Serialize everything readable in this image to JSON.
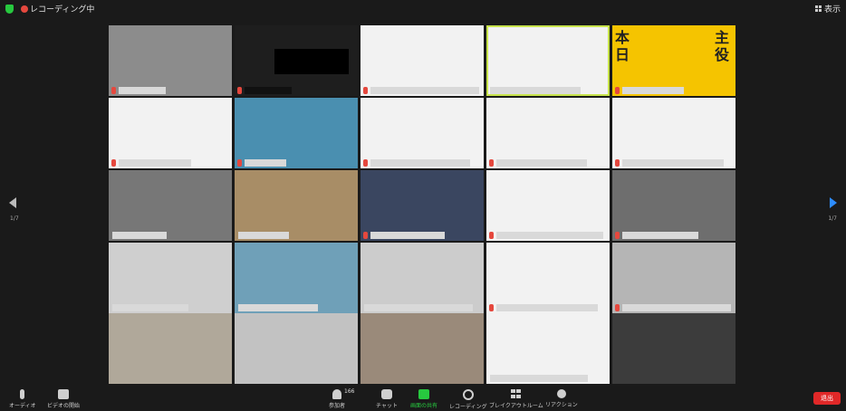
{
  "topbar": {
    "recording_label": "レコーディング中",
    "view_label": "表示"
  },
  "gallery": {
    "page_left": "1/7",
    "page_right": "1/7"
  },
  "tiles": [
    {
      "bg": "#8c8c8c"
    },
    {
      "bg": "#1e1e1e"
    },
    {
      "bg": "#f2f2f2"
    },
    {
      "bg": "#f2f2f2"
    },
    {
      "bg": "#f5c400"
    },
    {
      "bg": "#f2f2f2"
    },
    {
      "bg": "#4a8fb0"
    },
    {
      "bg": "#f2f2f2"
    },
    {
      "bg": "#f2f2f2"
    },
    {
      "bg": "#f2f2f2"
    },
    {
      "bg": "#777777"
    },
    {
      "bg": "#a88d66"
    },
    {
      "bg": "#3a4660"
    },
    {
      "bg": "#f2f2f2"
    },
    {
      "bg": "#6e6e6e"
    },
    {
      "bg": "#cfcfcf"
    },
    {
      "bg": "#6fa0b8"
    },
    {
      "bg": "#cccccc"
    },
    {
      "bg": "#f2f2f2"
    },
    {
      "bg": "#b5b5b5"
    },
    {
      "bg": "#b0a89a"
    },
    {
      "bg": "#c2c2c2"
    },
    {
      "bg": "#9a8a7a"
    },
    {
      "bg": "#f2f2f2"
    },
    {
      "bg": "#3c3c3c"
    }
  ],
  "tile_banner_text": {
    "left": "本日",
    "right": "主役"
  },
  "toolbar": {
    "audio": "オーディオ",
    "video": "ビデオの開始",
    "participants": "参加者",
    "participants_count": "166",
    "chat": "チャット",
    "share": "画面の共有",
    "record": "レコーディング",
    "breakout": "ブレイクアウトルーム",
    "reactions": "リアクション",
    "leave": "退出"
  },
  "colors": {
    "accent": "#2d8cff",
    "leave": "#e02828",
    "share": "#27c93f",
    "active_border": "#c7e34b"
  }
}
